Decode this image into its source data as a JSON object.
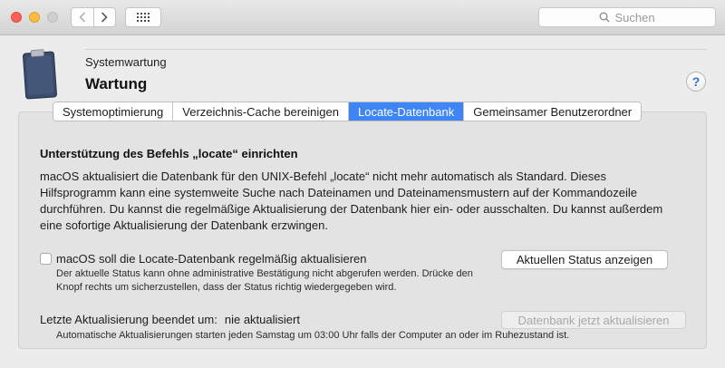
{
  "titlebar": {
    "search_placeholder": "Suchen",
    "icons": [
      "back-chevron-icon",
      "forward-chevron-icon",
      "grid-icon",
      "magnifier-icon"
    ]
  },
  "header": {
    "subtitle": "Systemwartung",
    "title": "Wartung",
    "help_label": "?",
    "icon": "clipboard-icon"
  },
  "tabs": [
    {
      "label": "Systemoptimierung",
      "active": false
    },
    {
      "label": "Verzeichnis-Cache bereinigen",
      "active": false
    },
    {
      "label": "Locate-Datenbank",
      "active": true
    },
    {
      "label": "Gemeinsamer Benutzerordner",
      "active": false
    }
  ],
  "content": {
    "heading": "Unterstützung des Befehls „locate“ einrichten",
    "description": "macOS aktualisiert die Datenbank für den UNIX-Befehl „locate“ nicht mehr automatisch als Standard. Dieses Hilfsprogramm kann eine systemweite Suche nach Dateinamen und Dateinamensmustern auf der Kommandozeile durchführen. Du kannst die regelmäßige Aktualisierung der Datenbank hier ein- oder ausschalten. Du kannst außerdem eine sofortige Aktualisierung der Datenbank erzwingen.",
    "checkbox_label": "macOS soll die Locate-Datenbank regelmäßig aktualisieren",
    "checkbox_checked": false,
    "status_note": "Der aktuelle Status kann ohne administrative Bestätigung nicht abgerufen werden. Drücke den Knopf rechts um sicherzustellen, dass der Status richtig wiedergegeben wird.",
    "status_button": "Aktuellen Status anzeigen",
    "last_update_label": "Letzte Aktualisierung beendet um:",
    "last_update_value": "nie aktualisiert",
    "update_button": "Datenbank jetzt aktualisieren",
    "update_button_enabled": false,
    "auto_note": "Automatische Aktualisierungen starten jeden Samstag um 03:00 Uhr falls der Computer an oder im Ruhezustand ist."
  },
  "colors": {
    "accent": "#3e86f5",
    "close": "#fc605b",
    "minimize": "#fdbc40"
  }
}
